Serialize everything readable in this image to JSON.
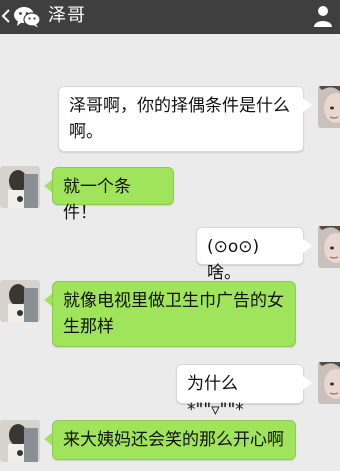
{
  "header": {
    "contact_name": "泽哥",
    "back_icon": "chevron-left-icon",
    "logo_icon": "wechat-logo-icon",
    "profile_icon": "person-icon"
  },
  "colors": {
    "header_bg": "#3f3f3f",
    "chat_bg": "#ebebeb",
    "bubble_sent": "#ffffff",
    "bubble_received": "#9fe45a"
  },
  "messages": [
    {
      "side": "right",
      "text": "泽哥啊，你的择偶条件是什么啊。"
    },
    {
      "side": "left",
      "text": "就一个条件！"
    },
    {
      "side": "right",
      "text": "(⊙o⊙)啥。"
    },
    {
      "side": "left",
      "text": "就像电视里做卫生巾广告的女生那样"
    },
    {
      "side": "right",
      "text": "为什么*\"\"▿\"\"*"
    },
    {
      "side": "left",
      "text": "来大姨妈还会笑的那么开心啊"
    }
  ]
}
